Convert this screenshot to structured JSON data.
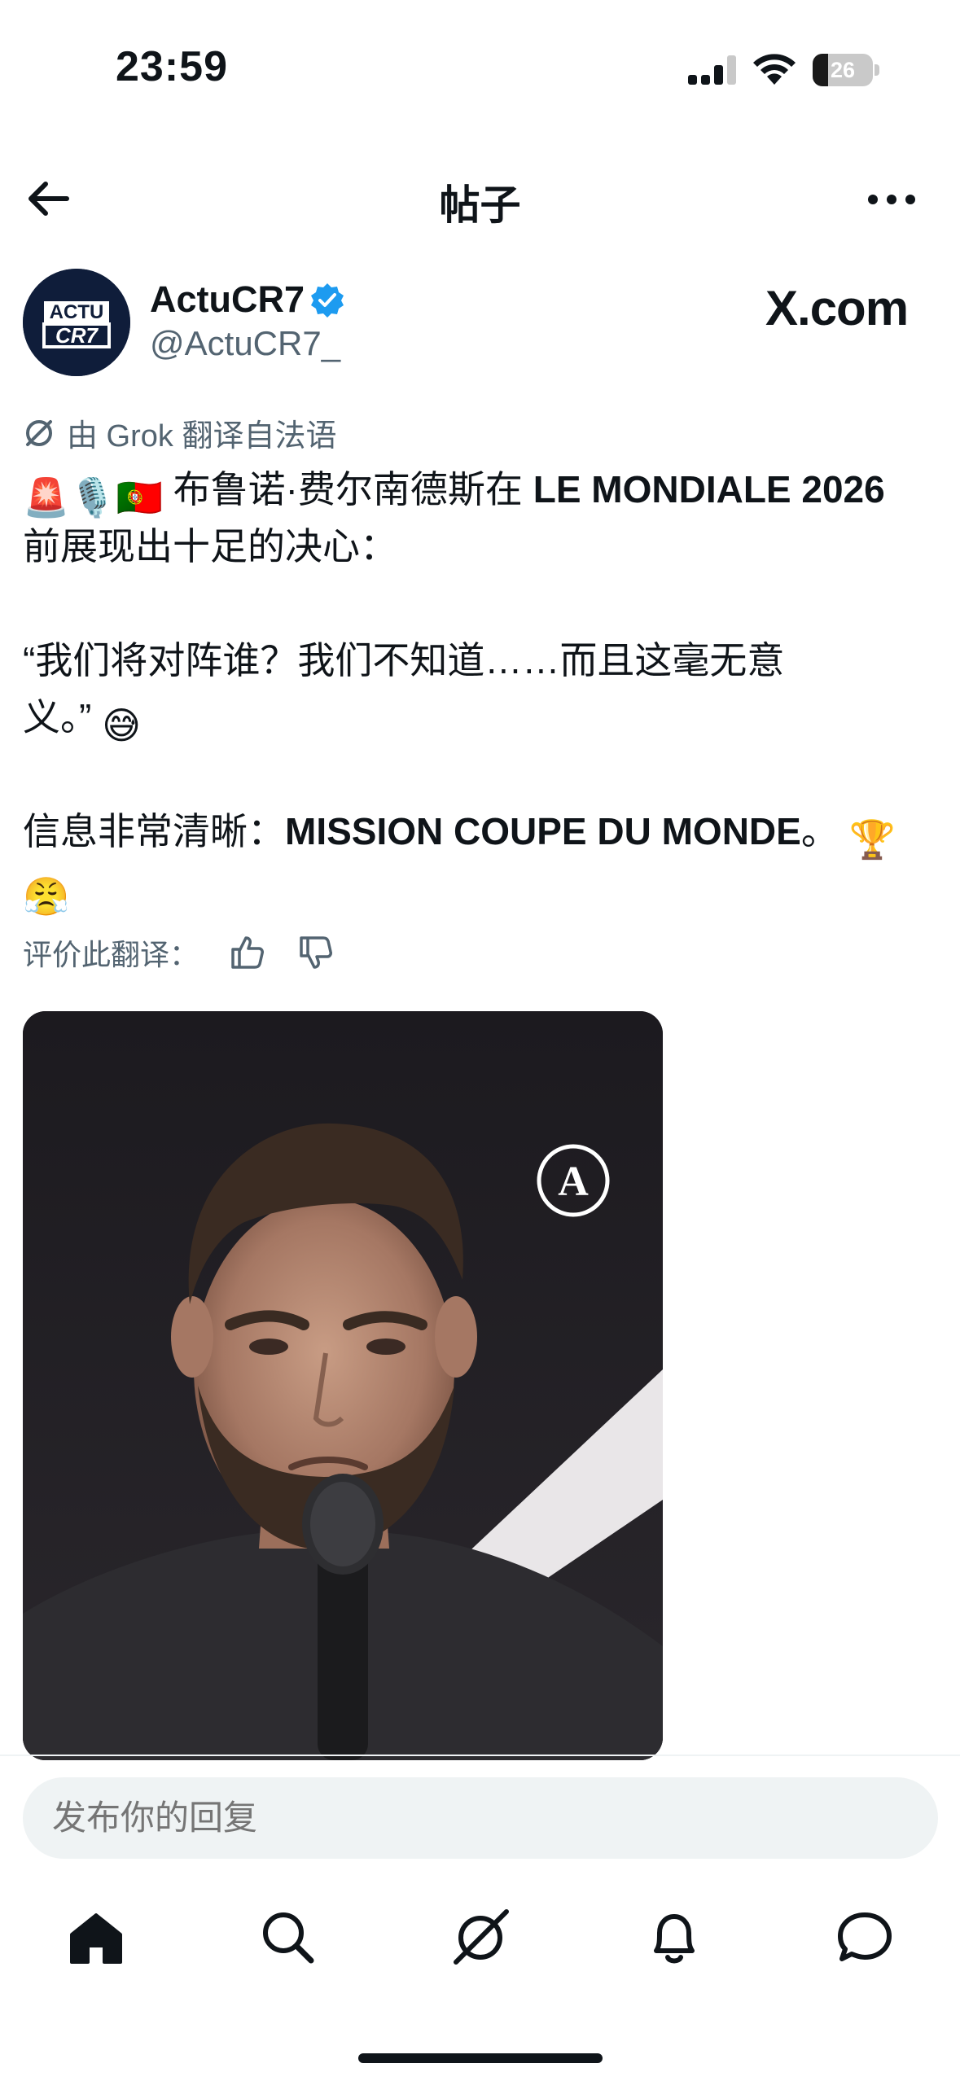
{
  "status_bar": {
    "time": "23:59",
    "battery_level": "26",
    "battery_fraction": 0.26,
    "icons": [
      "signal-icon",
      "wifi-icon",
      "battery-icon"
    ]
  },
  "header": {
    "title": "帖子",
    "back_icon": "arrow-left-icon",
    "more_icon": "more-horizontal-icon"
  },
  "post": {
    "author": {
      "name": "ActuCR7",
      "handle": "@ActuCR7_",
      "avatar_text_top": "ACTU",
      "avatar_text_bottom": "CR7",
      "verified": true
    },
    "watermark": "X.com",
    "translation_note": "由 Grok 翻译自法语",
    "body": {
      "line1_emojis": "🚨🎙️🇵🇹",
      "line1_text": " 布鲁诺·费尔南德斯在 ",
      "line1_bold": "LE MONDIALE 2026",
      "line2": "前展现出十足的决心：",
      "quote_line1": "“我们将对阵谁？我们不知道……而且这毫无意",
      "quote_line2": "义。” ",
      "quote_emoji": "😅",
      "final_text": "信息非常清晰：",
      "final_bold": "MISSION COUPE DU MONDE",
      "final_end": "。 ",
      "final_emoji1": "🏆",
      "final_emoji2": "😤"
    },
    "rate_label": "评价此翻译：",
    "media_logo": "A"
  },
  "reply": {
    "placeholder": "发布你的回复"
  },
  "bottom_nav": {
    "items": [
      "home-icon",
      "search-icon",
      "grok-icon",
      "notifications-bell-icon",
      "messages-icon"
    ]
  },
  "colors": {
    "text_primary": "#0f1419",
    "text_secondary": "#536471",
    "verified_blue": "#1d9bf0",
    "reply_bg": "#eff3f4"
  }
}
